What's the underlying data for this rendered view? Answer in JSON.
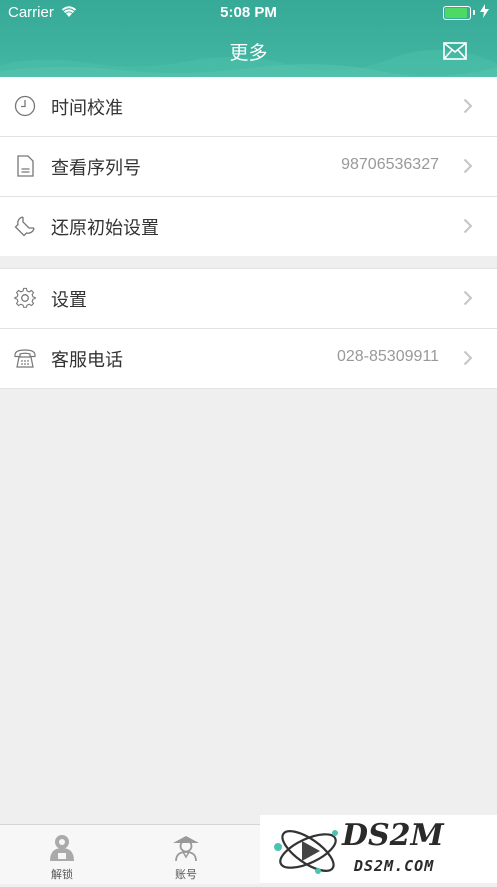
{
  "status_bar": {
    "carrier": "Carrier",
    "time": "5:08 PM",
    "battery_level": 1.0
  },
  "header": {
    "title": "更多"
  },
  "menu": {
    "group1": [
      {
        "label": "时间校准",
        "value": "",
        "icon": "clock-icon"
      },
      {
        "label": "查看序列号",
        "value": "98706536327",
        "icon": "document-icon"
      },
      {
        "label": "还原初始设置",
        "value": "",
        "icon": "wrench-icon"
      }
    ],
    "group2": [
      {
        "label": "设置",
        "value": "",
        "icon": "gear-icon"
      },
      {
        "label": "客服电话",
        "value": "028-85309911",
        "icon": "telephone-icon"
      }
    ]
  },
  "tabbar": {
    "tabs": [
      {
        "label": "解锁",
        "icon": "unlock-person-icon"
      },
      {
        "label": "账号",
        "icon": "account-person-icon"
      }
    ]
  },
  "watermark": {
    "logo_text": "DS2M",
    "site_text": "DS2M.COM"
  },
  "colors": {
    "header_green": "#3fb39f",
    "battery_green": "#4cd964",
    "background": "#efefef"
  }
}
